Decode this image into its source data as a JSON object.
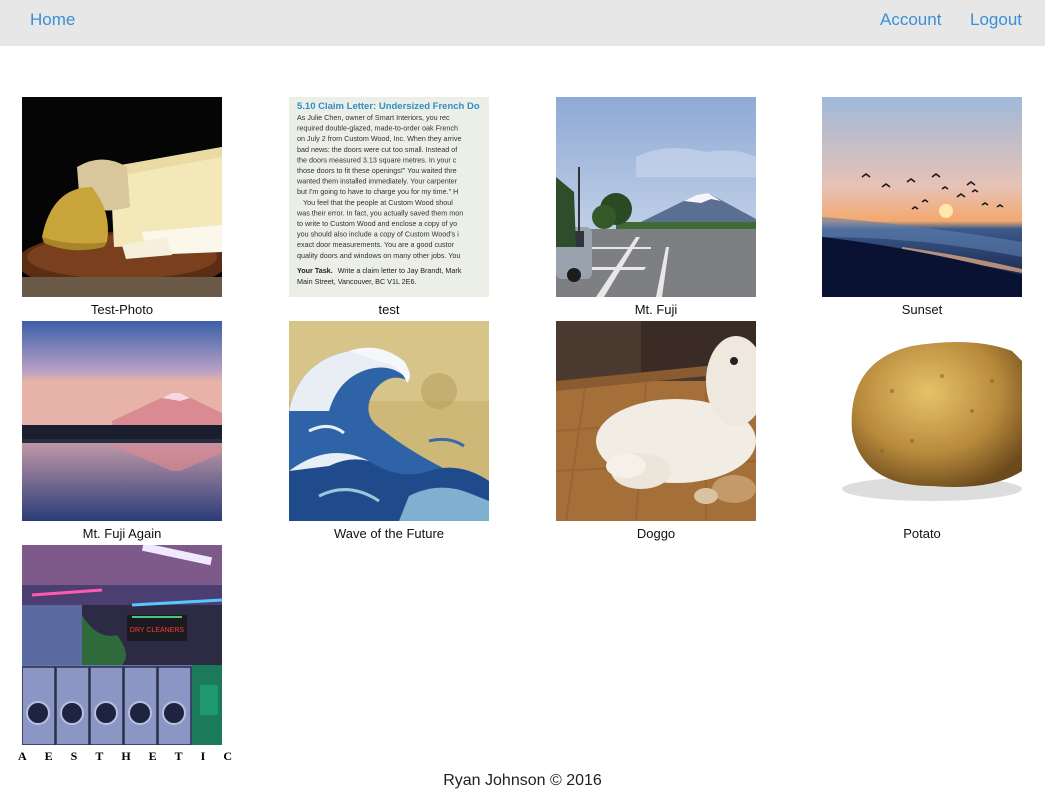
{
  "nav": {
    "home": "Home",
    "account": "Account",
    "logout": "Logout"
  },
  "gallery": [
    {
      "caption": "Test-Photo"
    },
    {
      "caption": "test"
    },
    {
      "caption": "Mt. Fuji"
    },
    {
      "caption": "Sunset"
    },
    {
      "caption": "Mt. Fuji Again"
    },
    {
      "caption": "Wave of the Future"
    },
    {
      "caption": "Doggo"
    },
    {
      "caption": "Potato"
    },
    {
      "caption": "A E S T H E T I C",
      "letters": [
        "A",
        "E",
        "S",
        "T",
        "H",
        "E",
        "T",
        "I",
        "C"
      ]
    }
  ],
  "document_thumb": {
    "heading": "5.10 Claim Letter: Undersized French Do",
    "lines": [
      "As Julie Chen, owner of Smart Interiors, you rec",
      "required double-glazed, made-to-order oak French",
      "on July 2 from Custom Wood, Inc. When they arrive",
      "bad news: the doors were cut too small. Instead of",
      "the doors measured 3.13 square metres. In your c",
      "those doors to fit these openings!\" You waited thre",
      "wanted them installed immediately. Your carpenter",
      "but I'm going to have to charge you for my time.\" H",
      "You feel that the people at Custom Wood shoul",
      "was their error. In fact, you actually saved them mon",
      "to write to Custom Wood and enclose a copy of yo",
      "you should also include a copy of Custom Wood's i",
      "exact door measurements. You are a good custor",
      "quality doors and windows on many other jobs. You"
    ],
    "task_label": "Your Task.",
    "task_lines": [
      "Write a claim letter to Jay Brandt, Mark",
      "Main Street, Vancouver, BC V1L 2E6."
    ]
  },
  "laundromat_sign": "DRY CLEANERS",
  "footer": "Ryan Johnson © 2016"
}
